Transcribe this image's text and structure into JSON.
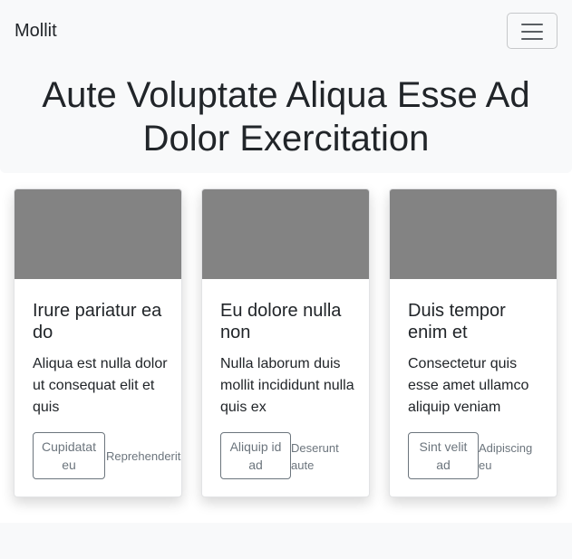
{
  "navbar": {
    "brand": "Mollit",
    "toggler_icon": "hamburger-icon"
  },
  "hero": {
    "title": "Aute Voluptate Aliqua Esse Ad Dolor Exercitation"
  },
  "cards": [
    {
      "title": "Irure pariatur ea do",
      "text": "Aliqua est nulla dolor ut consequat elit et quis",
      "primary_button": "Cupidatat eu",
      "secondary_link": "Reprehenderit"
    },
    {
      "title": "Eu dolore nulla non",
      "text": "Nulla laborum duis mollit incididunt nulla quis ex",
      "primary_button": "Aliquip id ad",
      "secondary_link": "Deserunt aute"
    },
    {
      "title": "Duis tempor enim et",
      "text": "Consectetur quis esse amet ullamco aliquip veniam",
      "primary_button": "Sint velit ad",
      "secondary_link": "Adipiscing eu"
    }
  ],
  "colors": {
    "navbar_bg": "#f8f9fa",
    "card_image_placeholder": "#838383",
    "secondary_text": "#6c757d"
  }
}
